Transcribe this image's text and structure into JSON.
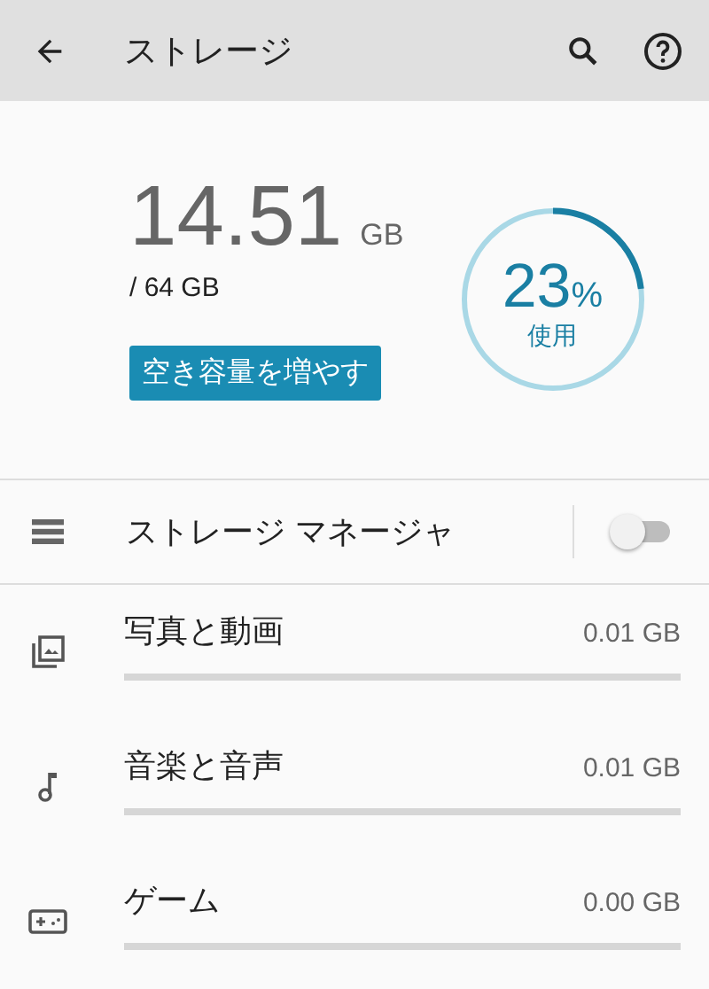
{
  "app_bar": {
    "title": "ストレージ"
  },
  "summary": {
    "used": "14.51",
    "used_unit": "GB",
    "total": "/ 64 GB",
    "percent": "23",
    "percent_sign": "%",
    "percent_label": "使用",
    "level": 0.23,
    "free_button": "空き容量を増やす"
  },
  "storage_manager": {
    "label": "ストレージ マネージャ",
    "on": false
  },
  "categories": [
    {
      "kind": "photos",
      "label": "写真と動画",
      "size": "0.01 GB",
      "level": 0
    },
    {
      "kind": "music",
      "label": "音楽と音声",
      "size": "0.01 GB",
      "level": 0
    },
    {
      "kind": "games",
      "label": "ゲーム",
      "size": "0.00 GB",
      "level": 0
    }
  ]
}
